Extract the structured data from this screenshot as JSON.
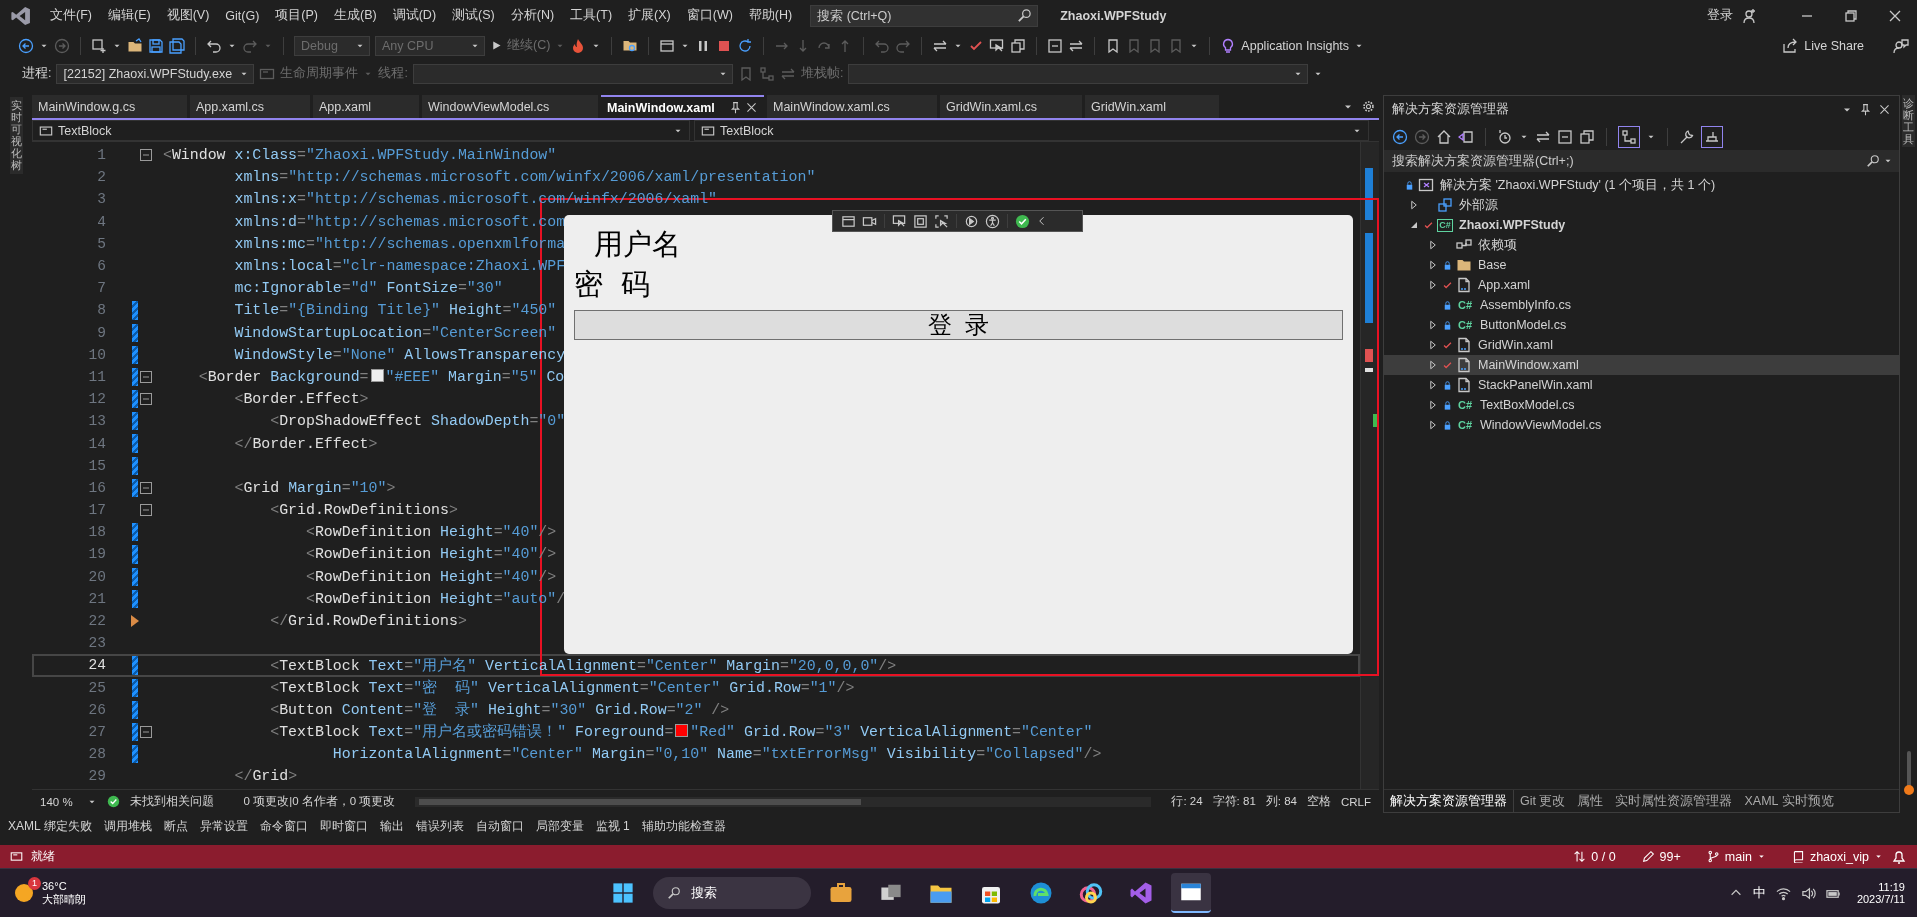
{
  "window": {
    "title": "Zhaoxi.WPFStudy",
    "sign_in": "登录"
  },
  "menu": [
    "文件(F)",
    "编辑(E)",
    "视图(V)",
    "Git(G)",
    "项目(P)",
    "生成(B)",
    "调试(D)",
    "测试(S)",
    "分析(N)",
    "工具(T)",
    "扩展(X)",
    "窗口(W)",
    "帮助(H)"
  ],
  "search": {
    "placeholder": "搜索 (Ctrl+Q)"
  },
  "toolbar": {
    "configuration": {
      "value": "Debug",
      "disabled": true
    },
    "platform": {
      "value": "Any CPU",
      "disabled": true
    },
    "continue_button": {
      "label": "继续(C)",
      "disabled": true
    },
    "app_insights": "Application Insights",
    "live_share": "Live Share"
  },
  "debug_location": {
    "process_label": "进程:",
    "process": "[22152] Zhaoxi.WPFStudy.exe",
    "lifecycle": {
      "label": "生命周期事件",
      "disabled": true
    },
    "thread": {
      "label": "线程:",
      "disabled": true
    },
    "stack": {
      "label": "堆栈帧:",
      "disabled": true
    }
  },
  "left_strip": "实时可视化树",
  "right_strip": "诊断工具",
  "tabs": [
    {
      "label": "MainWindow.g.cs",
      "selected": false
    },
    {
      "label": "App.xaml.cs",
      "selected": false
    },
    {
      "label": "App.xaml",
      "selected": false
    },
    {
      "label": "WindowViewModel.cs",
      "selected": false
    },
    {
      "label": "MainWindow.xaml",
      "selected": true
    },
    {
      "label": "MainWindow.xaml.cs",
      "selected": false
    },
    {
      "label": "GridWin.xaml.cs",
      "selected": false
    },
    {
      "label": "GridWin.xaml",
      "selected": false
    }
  ],
  "nav": [
    "TextBlock",
    "TextBlock"
  ],
  "code_lines": [
    {
      "n": "1",
      "text": "<Window x:Class=\"Zhaoxi.WPFStudy.MainWindow\"",
      "fold": true,
      "changed": false,
      "current": false,
      "arrow": false
    },
    {
      "n": "2",
      "text": "        xmlns=\"http://schemas.microsoft.com/winfx/2006/xaml/presentation\"",
      "fold": false,
      "changed": false,
      "current": false,
      "arrow": false
    },
    {
      "n": "3",
      "text": "        xmlns:x=\"http://schemas.microsoft.com/winfx/2006/xaml\"",
      "fold": false,
      "changed": false,
      "current": false,
      "arrow": false
    },
    {
      "n": "4",
      "text": "        xmlns:d=\"http://schemas.microsoft.com",
      "fold": false,
      "changed": false,
      "current": false,
      "arrow": false
    },
    {
      "n": "5",
      "text": "        xmlns:mc=\"http://schemas.openxmlforma",
      "fold": false,
      "changed": false,
      "current": false,
      "arrow": false
    },
    {
      "n": "6",
      "text": "        xmlns:local=\"clr-namespace:Zhaoxi.WPF",
      "fold": false,
      "changed": false,
      "current": false,
      "arrow": false
    },
    {
      "n": "7",
      "text": "        mc:Ignorable=\"d\" FontSize=\"30\"",
      "fold": false,
      "changed": false,
      "current": false,
      "arrow": false
    },
    {
      "n": "8",
      "text": "        Title=\"{Binding Title}\" Height=\"450\"",
      "fold": false,
      "changed": true,
      "current": false,
      "arrow": false
    },
    {
      "n": "9",
      "text": "        WindowStartupLocation=\"CenterScreen\"",
      "fold": false,
      "changed": true,
      "current": false,
      "arrow": false
    },
    {
      "n": "10",
      "text": "        WindowStyle=\"None\" AllowsTransparency",
      "fold": false,
      "changed": true,
      "current": false,
      "arrow": false
    },
    {
      "n": "11",
      "text": "    <Border Background=",
      "color": "#eeeeee",
      "text_2": "\"#EEE\" Margin=\"5\" Co",
      "fold": true,
      "changed": true,
      "current": false,
      "arrow": false
    },
    {
      "n": "12",
      "text": "        <Border.Effect>",
      "fold": true,
      "changed": true,
      "current": false,
      "arrow": false
    },
    {
      "n": "13",
      "text": "            <DropShadowEffect ShadowDepth=\"0\"",
      "fold": false,
      "changed": true,
      "current": false,
      "arrow": false
    },
    {
      "n": "14",
      "text": "        </Border.Effect>",
      "fold": false,
      "changed": true,
      "current": false,
      "arrow": false
    },
    {
      "n": "15",
      "fold": false,
      "changed": true,
      "current": false,
      "arrow": false
    },
    {
      "n": "16",
      "text": "        <Grid Margin=\"10\">",
      "fold": true,
      "changed": true,
      "current": false,
      "arrow": false
    },
    {
      "n": "17",
      "text": "            <Grid.RowDefinitions>",
      "fold": true,
      "changed": false,
      "current": false,
      "arrow": false
    },
    {
      "n": "18",
      "text": "                <RowDefinition Height=\"40\"/>",
      "fold": false,
      "changed": true,
      "current": false,
      "arrow": false
    },
    {
      "n": "19",
      "text": "                <RowDefinition Height=\"40\"/>",
      "fold": false,
      "changed": true,
      "current": false,
      "arrow": false
    },
    {
      "n": "20",
      "text": "                <RowDefinition Height=\"40\"/>",
      "fold": false,
      "changed": true,
      "current": false,
      "arrow": false
    },
    {
      "n": "21",
      "text": "                <RowDefinition Height=\"auto\"/",
      "fold": false,
      "changed": true,
      "current": false,
      "arrow": false
    },
    {
      "n": "22",
      "text": "            </Grid.RowDefinitions>",
      "fold": false,
      "changed": false,
      "current": false,
      "arrow": true
    },
    {
      "n": "23",
      "fold": false,
      "changed": false,
      "current": false,
      "arrow": false
    },
    {
      "n": "24",
      "text": "            <TextBlock Text=\"用户名\" VerticalAlignment=\"Center\" Margin=\"20,0,0,0\"/>",
      "fold": false,
      "changed": true,
      "current": true,
      "arrow": false
    },
    {
      "n": "25",
      "text": "            <TextBlock Text=\"密  码\" VerticalAlignment=\"Center\" Grid.Row=\"1\"/>",
      "fold": false,
      "changed": true,
      "current": false,
      "arrow": false
    },
    {
      "n": "26",
      "text": "            <Button Content=\"登  录\" Height=\"30\" Grid.Row=\"2\" />",
      "fold": false,
      "changed": true,
      "current": false,
      "arrow": false
    },
    {
      "n": "27",
      "text": "            <TextBlock Text=\"用户名或密码错误！\" Foreground=",
      "color": "#ff0000",
      "text_2": "\"Red\" Grid.Row=\"3\" VerticalAlignment=\"Center\"",
      "fold": true,
      "changed": true,
      "current": false,
      "arrow": false
    },
    {
      "n": "28",
      "text": "                   HorizontalAlignment=\"Center\" Margin=\"0,10\" Name=\"txtErrorMsg\" Visibility=\"Collapsed\"/>",
      "fold": false,
      "changed": true,
      "current": false,
      "arrow": false
    },
    {
      "n": "29",
      "text": "        </Grid>",
      "fold": false,
      "changed": false,
      "current": false,
      "arrow": false
    }
  ],
  "preview_window": {
    "username_label": "用户名",
    "password_label": "密  码",
    "login_button": "登  录"
  },
  "editor_status": {
    "zoom": "140 %",
    "issues": "未找到相关问题",
    "changes": "0 项更改|0 名作者，0 项更改",
    "line": "行: 24",
    "char": "字符: 81",
    "col": "列: 84",
    "spaces": "空格",
    "eol": "CRLF"
  },
  "solution_explorer": {
    "title": "解决方案资源管理器",
    "search": {
      "placeholder": "搜索解决方案资源管理器(Ctrl+;)"
    },
    "tree": [
      {
        "label": "解决方案 'Zhaoxi.WPFStudy' (1 个项目，共 1 个)",
        "kind": "solution",
        "locked": true,
        "modified": false,
        "expandable": false,
        "selected": false,
        "children": [
          {
            "label": "外部源",
            "kind": "external",
            "locked": false,
            "modified": false,
            "expandable": true,
            "expanded": false,
            "selected": false
          },
          {
            "label": "Zhaoxi.WPFStudy",
            "kind": "project",
            "badge": "C#",
            "locked": false,
            "modified": true,
            "expandable": true,
            "expanded": true,
            "selected": false,
            "children": [
              {
                "label": "依赖项",
                "kind": "deps",
                "locked": false,
                "modified": false,
                "expandable": true,
                "expanded": false,
                "selected": false
              },
              {
                "label": "Base",
                "kind": "folder",
                "locked": true,
                "modified": false,
                "expandable": true,
                "expanded": false,
                "selected": false
              },
              {
                "label": "App.xaml",
                "kind": "xaml",
                "locked": false,
                "modified": true,
                "expandable": true,
                "expanded": false,
                "selected": false
              },
              {
                "label": "AssemblyInfo.cs",
                "kind": "cs",
                "badge": "C#",
                "locked": true,
                "modified": false,
                "expandable": false,
                "selected": false
              },
              {
                "label": "ButtonModel.cs",
                "kind": "cs",
                "badge": "C#",
                "locked": true,
                "modified": false,
                "expandable": true,
                "expanded": false,
                "selected": false
              },
              {
                "label": "GridWin.xaml",
                "kind": "xaml",
                "locked": false,
                "modified": true,
                "expandable": true,
                "expanded": false,
                "selected": false
              },
              {
                "label": "MainWindow.xaml",
                "kind": "xaml",
                "locked": false,
                "modified": true,
                "expandable": true,
                "expanded": false,
                "selected": true
              },
              {
                "label": "StackPanelWin.xaml",
                "kind": "xaml",
                "locked": true,
                "modified": false,
                "expandable": true,
                "expanded": false,
                "selected": false
              },
              {
                "label": "TextBoxModel.cs",
                "kind": "cs",
                "badge": "C#",
                "locked": true,
                "modified": false,
                "expandable": true,
                "expanded": false,
                "selected": false
              },
              {
                "label": "WindowViewModel.cs",
                "kind": "cs",
                "badge": "C#",
                "locked": true,
                "modified": false,
                "expandable": true,
                "expanded": false,
                "selected": false
              }
            ]
          }
        ]
      }
    ],
    "tabs": [
      {
        "label": "解决方案资源管理器",
        "selected": true
      },
      {
        "label": "Git 更改",
        "selected": false
      },
      {
        "label": "属性",
        "selected": false
      },
      {
        "label": "实时属性资源管理器",
        "selected": false
      },
      {
        "label": "XAML 实时预览",
        "selected": false
      }
    ]
  },
  "tool_tabs": [
    "XAML 绑定失败",
    "调用堆栈",
    "断点",
    "异常设置",
    "命令窗口",
    "即时窗口",
    "输出",
    "错误列表",
    "自动窗口",
    "局部变量",
    "监视 1",
    "辅助功能检查器"
  ],
  "status_bar": {
    "ready": "就绪",
    "sync": "0 / 0",
    "changes": "99+",
    "branch": "main",
    "repo": "zhaoxi_vip"
  },
  "taskbar": {
    "weather": {
      "badge": "1",
      "temp": "36°C",
      "condition": "大部晴朗"
    },
    "search": "搜索",
    "ime": "中",
    "time": "11:19",
    "date": "2023/7/11"
  }
}
